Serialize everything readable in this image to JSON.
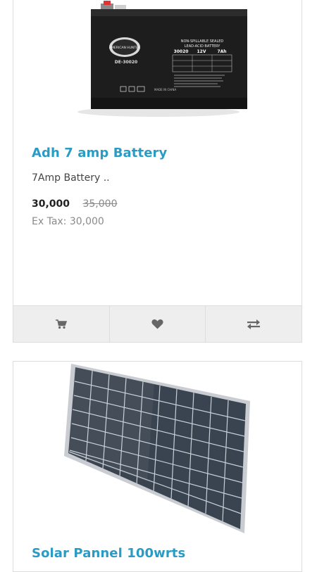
{
  "products": [
    {
      "image_alt": "7Amp sealed lead-acid battery",
      "battery_label": {
        "brand": "AMERICAN HUNTER",
        "model": "DE-30020",
        "type_line1": "NON-SPILLABLE SEALED",
        "type_line2": "LEAD-ACID BATTERY",
        "code": "30020",
        "voltage": "12V",
        "capacity": "7Ah",
        "made_in": "MADE IN CHINA"
      },
      "title": "Adh 7 amp Battery",
      "description": "7Amp Battery ..",
      "price_new": "30,000",
      "price_old": "35,000",
      "ex_tax": "Ex Tax: 30,000",
      "icons": {
        "cart": "cart-icon",
        "wishlist": "heart-icon",
        "compare": "compare-icon"
      }
    },
    {
      "image_alt": "Solar panel",
      "title": "Solar Pannel 100wrts"
    }
  ],
  "colors": {
    "title": "#2a9bc4",
    "button_bg": "#eeeeee",
    "border": "#dddddd",
    "icon": "#666666",
    "muted": "#8a8a8a"
  }
}
